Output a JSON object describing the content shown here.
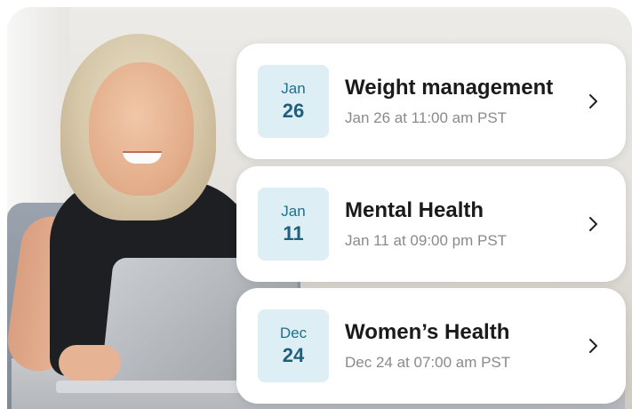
{
  "events": [
    {
      "month": "Jan",
      "day": "26",
      "title": "Weight management",
      "time": "Jan 26 at 11:00 am PST"
    },
    {
      "month": "Jan",
      "day": "11",
      "title": "Mental Health",
      "time": "Jan 11 at 09:00 pm PST"
    },
    {
      "month": "Dec",
      "day": "24",
      "title": "Women’s Health",
      "time": "Dec 24 at 07:00 am PST"
    }
  ],
  "icons": {
    "chevron": "chevron-right-icon"
  },
  "colors": {
    "date_tile_bg": "#ddeef5",
    "date_text": "#1f6f8e",
    "card_bg": "#ffffff"
  }
}
